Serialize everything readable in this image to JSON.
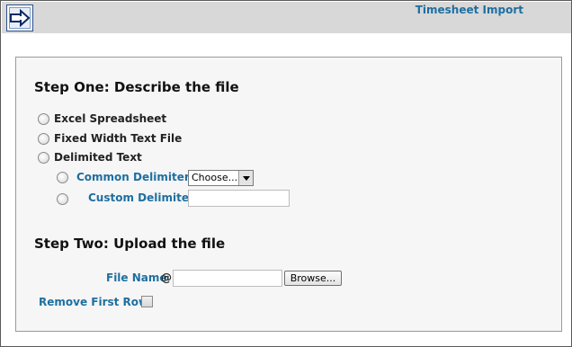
{
  "header": {
    "title": "Timesheet Import",
    "icon": "arrow-right-icon"
  },
  "step_one": {
    "heading": "Step One: Describe the file",
    "options": [
      {
        "label": "Excel Spreadsheet",
        "selected": false
      },
      {
        "label": "Fixed Width Text File",
        "selected": false
      },
      {
        "label": "Delimited Text",
        "selected": false
      }
    ],
    "delimiter_options": {
      "common_label": "Common Delimiters",
      "common_selected": "Choose...",
      "custom_label": "Custom Delimiter",
      "custom_value": ""
    }
  },
  "step_two": {
    "heading": "Step Two: Upload the file",
    "file_name_label": "File Name",
    "at_symbol": "@",
    "file_value": "",
    "browse_label": "Browse...",
    "remove_first_row_label": "Remove First Row",
    "remove_first_row_checked": false
  },
  "colors": {
    "accent": "#1e6fa0",
    "header_bg": "#d8d8d8",
    "panel_bg": "#f6f6f6"
  }
}
